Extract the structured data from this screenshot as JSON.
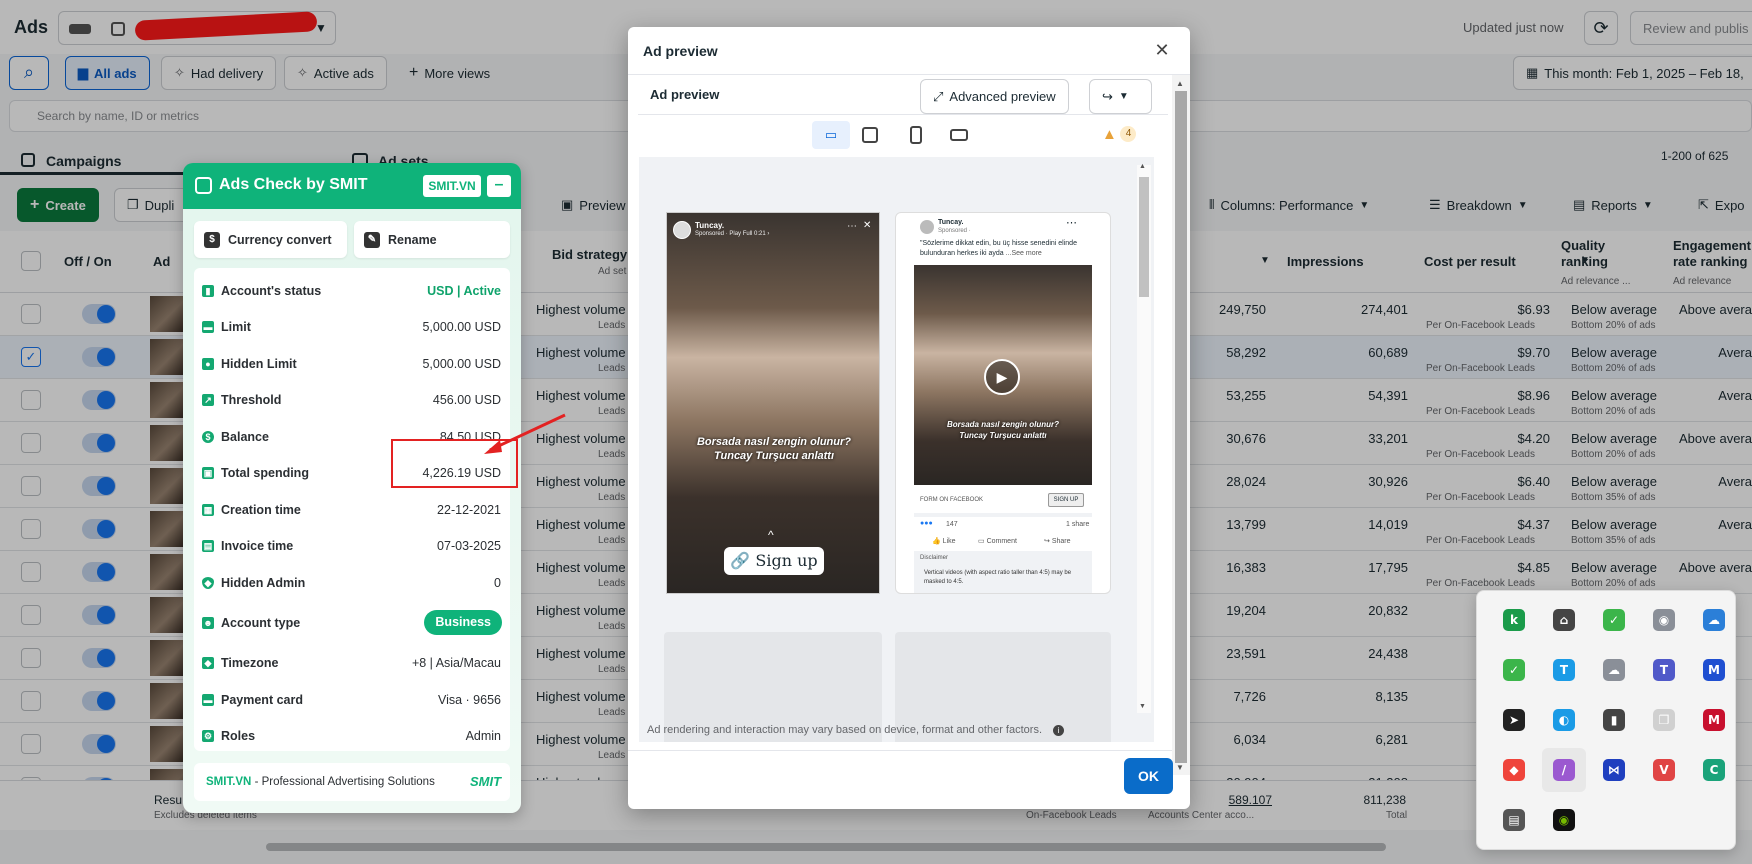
{
  "header": {
    "title": "Ads",
    "updated": "Updated just now",
    "review_publish": "Review and publis",
    "date_range": "This month: Feb 1, 2025 – Feb 18,",
    "search_placeholder": "Search by name, ID or metrics"
  },
  "views": {
    "all_ads": "All ads",
    "had_delivery": "Had delivery",
    "active_ads": "Active ads",
    "more_views": "More views"
  },
  "tabs": {
    "campaigns": "Campaigns",
    "ad_sets": "Ad sets"
  },
  "pagination": "1-200 of 625",
  "toolbar": {
    "create": "Create",
    "duplicate": "Dupli",
    "preview": "Preview",
    "columns": "Columns: Performance",
    "breakdown": "Breakdown",
    "reports": "Reports",
    "export": "Expo"
  },
  "columns": {
    "off_on": "Off / On",
    "ad": "Ad",
    "bid_strategy": "Bid strategy",
    "bid_sub": "Ad set",
    "impressions": "Impressions",
    "cost_per_result": "Cost per result",
    "quality_ranking": "Quality ranking",
    "quality_sub": "Ad relevance ...",
    "engagement_ranking": "Engagement rate ranking",
    "engagement_sub": "Ad relevance"
  },
  "rows": [
    {
      "bid": "Highest volume",
      "bid_sub": "Leads",
      "reach": "249,750",
      "impressions": "274,401",
      "cpr": "$6.93",
      "cpr_sub": "Per On-Facebook Leads",
      "quality": "Below average",
      "quality_sub": "Bottom 20% of ads",
      "engagement": "Above avera",
      "checked": false
    },
    {
      "bid": "Highest volume",
      "bid_sub": "Leads",
      "reach": "58,292",
      "impressions": "60,689",
      "cpr": "$9.70",
      "cpr_sub": "Per On-Facebook Leads",
      "quality": "Below average",
      "quality_sub": "Bottom 20% of ads",
      "engagement": "Avera",
      "checked": true
    },
    {
      "bid": "Highest volume",
      "bid_sub": "Leads",
      "reach": "53,255",
      "impressions": "54,391",
      "cpr": "$8.96",
      "cpr_sub": "Per On-Facebook Leads",
      "quality": "Below average",
      "quality_sub": "Bottom 20% of ads",
      "engagement": "Avera",
      "checked": false
    },
    {
      "bid": "Highest volume",
      "bid_sub": "Leads",
      "reach": "30,676",
      "impressions": "33,201",
      "cpr": "$4.20",
      "cpr_sub": "Per On-Facebook Leads",
      "quality": "Below average",
      "quality_sub": "Bottom 20% of ads",
      "engagement": "Above avera",
      "checked": false
    },
    {
      "bid": "Highest volume",
      "bid_sub": "Leads",
      "reach": "28,024",
      "impressions": "30,926",
      "cpr": "$6.40",
      "cpr_sub": "Per On-Facebook Leads",
      "quality": "Below average",
      "quality_sub": "Bottom 35% of ads",
      "engagement": "Avera",
      "checked": false
    },
    {
      "bid": "Highest volume",
      "bid_sub": "Leads",
      "reach": "13,799",
      "impressions": "14,019",
      "cpr": "$4.37",
      "cpr_sub": "Per On-Facebook Leads",
      "quality": "Below average",
      "quality_sub": "Bottom 35% of ads",
      "engagement": "Avera",
      "checked": false
    },
    {
      "bid": "Highest volume",
      "bid_sub": "Leads",
      "reach": "16,383",
      "impressions": "17,795",
      "cpr": "$4.85",
      "cpr_sub": "Per On-Facebook Leads",
      "quality": "Below average",
      "quality_sub": "Bottom 20% of ads",
      "engagement": "Above avera",
      "checked": false
    },
    {
      "bid": "Highest volume",
      "bid_sub": "Leads",
      "reach": "19,204",
      "impressions": "20,832",
      "cpr": "",
      "cpr_sub": "",
      "quality": "",
      "quality_sub": "",
      "engagement": "",
      "checked": false
    },
    {
      "bid": "Highest volume",
      "bid_sub": "Leads",
      "reach": "23,591",
      "impressions": "24,438",
      "cpr": "",
      "cpr_sub": "",
      "quality": "",
      "quality_sub": "",
      "engagement": "",
      "checked": false
    },
    {
      "bid": "Highest volume",
      "bid_sub": "Leads",
      "reach": "7,726",
      "impressions": "8,135",
      "cpr": "",
      "cpr_sub": "",
      "quality": "",
      "quality_sub": "",
      "engagement": "",
      "checked": false
    },
    {
      "bid": "Highest volume",
      "bid_sub": "Leads",
      "reach": "6,034",
      "impressions": "6,281",
      "cpr": "",
      "cpr_sub": "",
      "quality": "",
      "quality_sub": "",
      "engagement": "",
      "checked": false
    },
    {
      "bid": "Highest volume",
      "bid_sub": "",
      "reach": "20,904",
      "impressions": "21,208",
      "cpr": "",
      "cpr_sub": "",
      "quality": "",
      "quality_sub": "",
      "engagement": "",
      "checked": false
    }
  ],
  "summary": {
    "results_label": "Resu",
    "excludes": "Excludes deleted items",
    "cpr_total": "589.107",
    "cpr_total_sub": "Accounts Center acco...",
    "reach_sub": "On-Facebook Leads",
    "impressions_total": "811,238",
    "impressions_sub": "Total"
  },
  "smit": {
    "title": "Ads Check by SMIT",
    "badge": "SMIT.VN",
    "currency_convert": "Currency convert",
    "rename": "Rename",
    "rows": [
      {
        "label": "Account's status",
        "value": "USD | Active"
      },
      {
        "label": "Limit",
        "value": "5,000.00 USD"
      },
      {
        "label": "Hidden Limit",
        "value": "5,000.00 USD"
      },
      {
        "label": "Threshold",
        "value": "456.00 USD"
      },
      {
        "label": "Balance",
        "value": "84.50 USD"
      },
      {
        "label": "Total spending",
        "value": "4,226.19 USD"
      },
      {
        "label": "Creation time",
        "value": "22-12-2021"
      },
      {
        "label": "Invoice time",
        "value": "07-03-2025"
      },
      {
        "label": "Hidden Admin",
        "value": "0"
      },
      {
        "label": "Account type",
        "value": "Business"
      },
      {
        "label": "Timezone",
        "value": "+8 | Asia/Macau"
      },
      {
        "label": "Payment card",
        "value": "Visa · 9656"
      },
      {
        "label": "Roles",
        "value": "Admin"
      }
    ],
    "footer_brand": "SMIT.VN",
    "footer_text": " - Professional Advertising Solutions",
    "footer_logo": "SMIT"
  },
  "modal": {
    "title": "Ad preview",
    "subtitle": "Ad preview",
    "advanced_preview": "Advanced preview",
    "warning_count": "4",
    "story": {
      "page": "Tuncay.",
      "sponsored": "Sponsored · Play Full 0:21 ›",
      "caption1": "Borsada nasıl zengin olunur?",
      "caption2": "Tuncay Turşucu anlattı",
      "cta": "Sign up"
    },
    "feed": {
      "page": "Tuncay.",
      "sponsored": "Sponsored · ",
      "text": "\"Sözlerime dikkat edin, bu üç hisse senedini elinde bulunduran herkes iki ayda",
      "see_more": "...See more",
      "caption1": "Borsada nasıl zengin olunur?",
      "caption2": "Tuncay Turşucu anlattı",
      "form_label": "FORM ON FACEBOOK",
      "sign_up": "SIGN UP",
      "reactions": "147",
      "shares": "1 share",
      "like": "Like",
      "comment": "Comment",
      "share": "Share",
      "disclaimer": "Disclaimer",
      "disclaimer_text": "Vertical videos (with aspect ratio taller than 4:5) may be masked to 4:5."
    },
    "footer_note": "Ad rendering and interaction may vary based on device, format and other factors.",
    "ok": "OK"
  },
  "colors": {
    "smit_green": "#0fb37a",
    "fb_blue": "#1877f2",
    "ok_blue": "#0a6cc9",
    "annotation_red": "#e32222"
  }
}
